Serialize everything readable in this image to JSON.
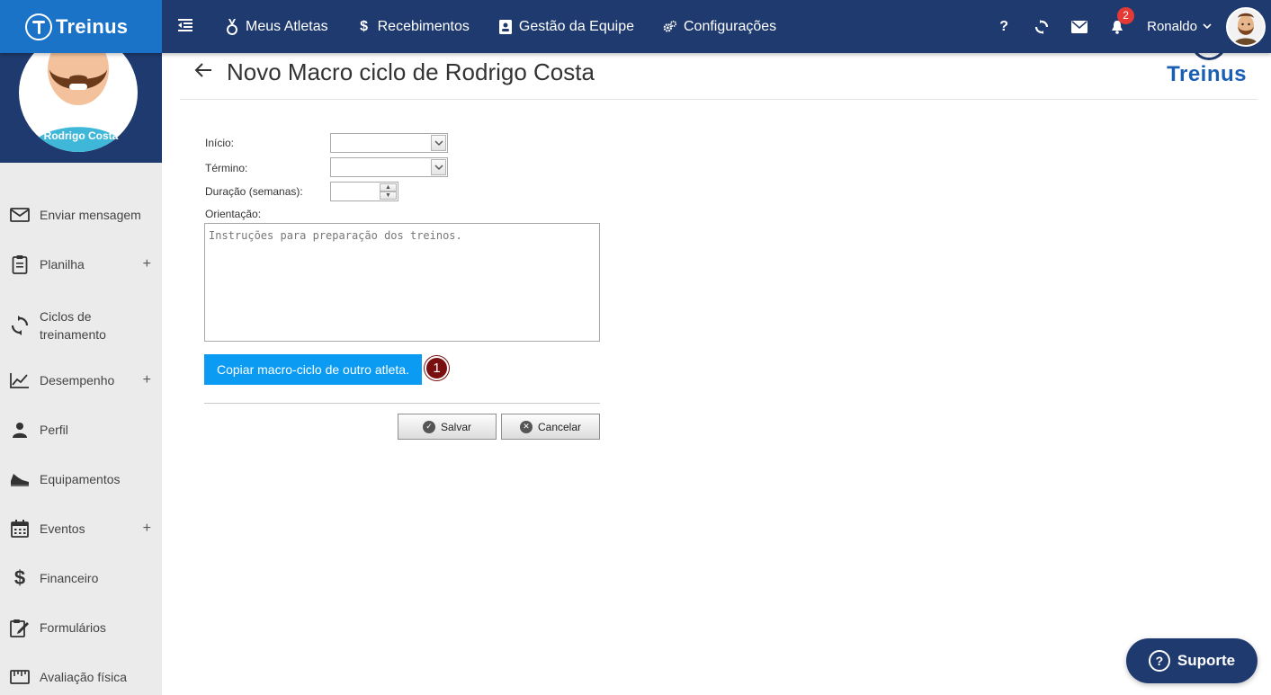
{
  "brand": {
    "name": "Treinus"
  },
  "nav": {
    "items": [
      {
        "label": "Meus Atletas",
        "icon": "medal-icon"
      },
      {
        "label": "Recebimentos",
        "icon": "dollar-icon"
      },
      {
        "label": "Gestão da Equipe",
        "icon": "contact-card-icon"
      },
      {
        "label": "Configurações",
        "icon": "gears-icon"
      }
    ]
  },
  "topright": {
    "help": "?",
    "notifications_count": "2",
    "user_name": "Ronaldo"
  },
  "sidebar": {
    "athlete_name": "Rodrigo Costa",
    "items": [
      {
        "label": "Enviar mensagem",
        "icon": "envelope-icon"
      },
      {
        "label": "Planilha",
        "icon": "clipboard-icon",
        "plus": "+"
      },
      {
        "label": "Ciclos de treinamento",
        "icon": "cycle-icon"
      },
      {
        "label": "Desempenho",
        "icon": "chart-line-icon",
        "plus": "+"
      },
      {
        "label": "Perfil",
        "icon": "person-icon"
      },
      {
        "label": "Equipamentos",
        "icon": "shoe-icon"
      },
      {
        "label": "Eventos",
        "icon": "calendar-icon",
        "plus": "+"
      },
      {
        "label": "Financeiro",
        "icon": "dollar-icon"
      },
      {
        "label": "Formulários",
        "icon": "edit-form-icon"
      },
      {
        "label": "Avaliação física",
        "icon": "ruler-icon"
      }
    ]
  },
  "page": {
    "title": "Novo Macro ciclo de Rodrigo Costa",
    "logo_text": "Treinus"
  },
  "form": {
    "inicio_label": "Início:",
    "termino_label": "Término:",
    "duracao_label": "Duração (semanas):",
    "orientacao_label": "Orientação:",
    "orientacao_placeholder": "Instruções para preparação dos treinos.",
    "copy_button": "Copiar macro-ciclo de outro atleta.",
    "step_number": "1",
    "save_button": "Salvar",
    "cancel_button": "Cancelar"
  },
  "support": {
    "label": "Suporte"
  }
}
